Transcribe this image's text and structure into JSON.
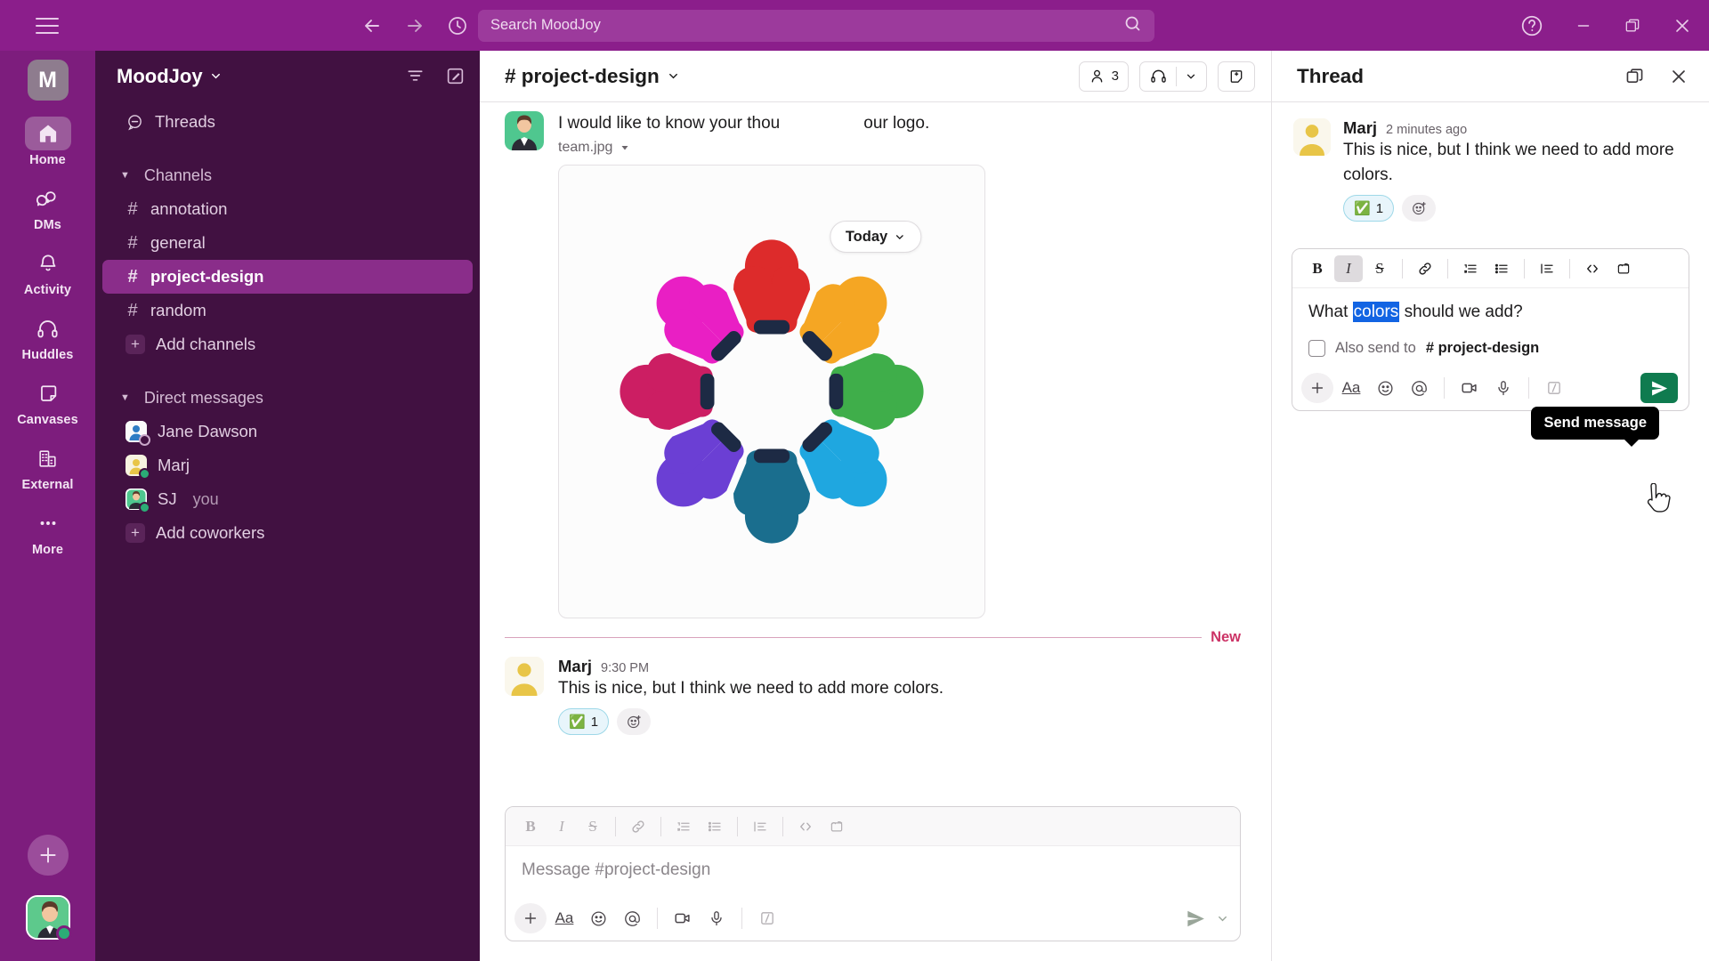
{
  "topbar": {
    "menu_icon": "hamburger-icon",
    "back_icon": "arrow-left-icon",
    "forward_icon": "arrow-right-icon",
    "history_icon": "clock-icon",
    "search_placeholder": "Search MoodJoy",
    "search_icon": "magnifier-icon",
    "help_icon": "help-circle-icon",
    "minimize_icon": "minimize-icon",
    "maximize_icon": "restore-icon",
    "close_icon": "close-icon"
  },
  "rail": {
    "workspace_initial": "M",
    "items": [
      {
        "label": "Home",
        "icon": "home-icon",
        "active": true
      },
      {
        "label": "DMs",
        "icon": "dms-icon",
        "active": false
      },
      {
        "label": "Activity",
        "icon": "bell-icon",
        "active": false
      },
      {
        "label": "Huddles",
        "icon": "headphones-icon",
        "active": false
      },
      {
        "label": "Canvases",
        "icon": "canvas-icon",
        "active": false
      },
      {
        "label": "External",
        "icon": "building-icon",
        "active": false
      },
      {
        "label": "More",
        "icon": "ellipsis-icon",
        "active": false
      }
    ],
    "add_label": "+"
  },
  "sidebar": {
    "workspace_name": "MoodJoy",
    "filter_icon": "filter-icon",
    "compose_icon": "compose-icon",
    "threads_label": "Threads",
    "channels_section": "Channels",
    "channels": [
      {
        "name": "annotation",
        "active": false
      },
      {
        "name": "general",
        "active": false
      },
      {
        "name": "project-design",
        "active": true
      },
      {
        "name": "random",
        "active": false
      }
    ],
    "add_channels_label": "Add channels",
    "dm_section": "Direct messages",
    "dms": [
      {
        "name": "Jane Dawson",
        "you": "",
        "presence": "away",
        "avatar_color": "#2E7CC4"
      },
      {
        "name": "Marj",
        "you": "",
        "presence": "online",
        "avatar_color": "#E8C547"
      },
      {
        "name": "SJ",
        "you": "you",
        "presence": "online",
        "avatar_color": "#4FC78F"
      }
    ],
    "add_coworkers_label": "Add coworkers"
  },
  "channel": {
    "name": "# project-design",
    "members_count": "3",
    "members_icon": "person-icon",
    "huddle_icon": "headphones-icon",
    "huddle_caret": "chevron-down-icon",
    "canvas_icon": "add-canvas-icon",
    "date_pill": "Today",
    "messages": [
      {
        "author": "",
        "time": "",
        "text_before": "I would like to know your thou",
        "text_after": "our logo.",
        "filename": "team.jpg",
        "avatar_type": "photo"
      },
      {
        "author": "Marj",
        "time": "9:30 PM",
        "text": "This is nice, but I think we need to add more colors.",
        "reaction_emoji": "✅",
        "reaction_count": "1",
        "avatar_type": "yellow"
      }
    ],
    "new_divider_label": "New",
    "composer": {
      "placeholder": "Message #project-design",
      "format_buttons": [
        "B",
        "I",
        "S",
        "link-icon",
        "ordered-list-icon",
        "bulleted-list-icon",
        "blockquote-icon",
        "code-icon",
        "code-block-icon"
      ],
      "action_icons": [
        "plus-icon",
        "Aa",
        "emoji-icon",
        "mention-icon",
        "video-icon",
        "mic-icon",
        "slash-command-icon"
      ],
      "send_icon": "send-icon",
      "send_caret": "chevron-down-icon"
    }
  },
  "thread": {
    "title": "Thread",
    "expand_icon": "open-in-window-icon",
    "close_icon": "close-icon",
    "root_message": {
      "author": "Marj",
      "time": "2 minutes ago",
      "text": "This is nice, but I think we need to add more colors.",
      "reaction_emoji": "✅",
      "reaction_count": "1"
    },
    "composer": {
      "value_before": "What ",
      "value_selected": "colors",
      "value_after": " should we add?",
      "italic_active": true,
      "also_send_label": "Also send to",
      "also_send_channel": "# project-design",
      "send_icon": "send-icon"
    },
    "tooltip": "Send message"
  },
  "colors": {
    "brand_purple": "#7D1D7D",
    "topbar_purple": "#8B1E8B",
    "sidebar_purple": "#411141",
    "active_channel": "#8A2D8A",
    "send_green": "#0F7B4F",
    "selection_blue": "#1264E3",
    "new_pink": "#CC3366"
  },
  "logo_image": {
    "alt": "eight colored people figures in a circle holding hands",
    "figure_colors": [
      "#DD2B2B",
      "#F5A623",
      "#3FAE4A",
      "#1FA7E0",
      "#1A6E8E",
      "#6B3FD4",
      "#CC1E63",
      "#E91FC4"
    ]
  }
}
